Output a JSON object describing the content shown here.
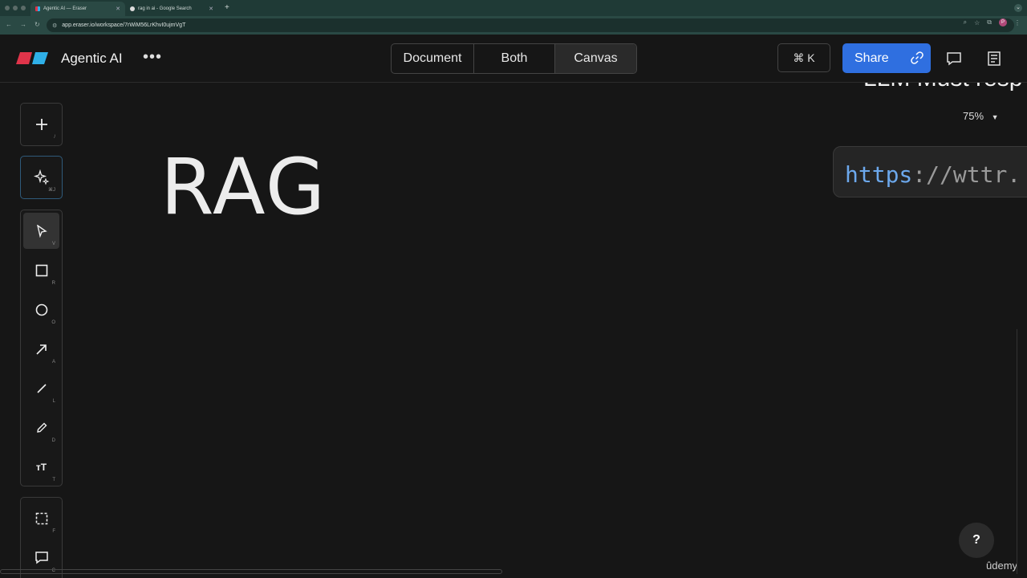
{
  "browser": {
    "tabs": [
      {
        "title": "Agentic AI — Eraser",
        "active": true
      },
      {
        "title": "rag in ai - Google Search",
        "active": false
      }
    ],
    "url": "app.eraser.io/workspace/7rWiM56LrKhvI0ujmVgT",
    "new_tab": "+",
    "profile_initial": "P"
  },
  "header": {
    "title": "Agentic AI",
    "more": "•••",
    "view_modes": [
      "Document",
      "Both",
      "Canvas"
    ],
    "active_mode": "Canvas",
    "cmdk_label": "⌘ K",
    "share_label": "Share"
  },
  "canvas": {
    "rag_text": "RAG",
    "llm_text": "LLM Must resp",
    "zoom": "75%",
    "code_prefix": "https",
    "code_rest": "://wttr."
  },
  "tools": [
    {
      "name": "add",
      "key": "/"
    },
    {
      "name": "ai-sparkle",
      "key": "⌘J"
    },
    {
      "name": "select",
      "key": "V"
    },
    {
      "name": "rectangle",
      "key": "R"
    },
    {
      "name": "ellipse",
      "key": "O"
    },
    {
      "name": "arrow",
      "key": "A"
    },
    {
      "name": "line",
      "key": "L"
    },
    {
      "name": "pencil",
      "key": "D"
    },
    {
      "name": "text",
      "key": "T"
    },
    {
      "name": "frame",
      "key": "F"
    },
    {
      "name": "comment",
      "key": "C"
    }
  ],
  "help_label": "?",
  "watermark": "ûdemy",
  "colors": {
    "accent": "#2f6fe0",
    "background": "#161616",
    "code_keyword": "#6ca8ec"
  }
}
